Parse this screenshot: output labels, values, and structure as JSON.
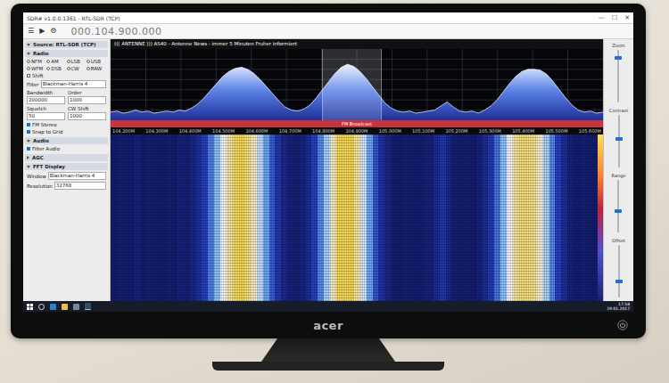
{
  "window": {
    "title": "SDR# v1.0.0.1361 - RTL-SDR (TCP)",
    "controls": [
      "—",
      "☐",
      "✕"
    ]
  },
  "toolbar": {
    "icons": [
      "☰",
      "▶",
      "⚙"
    ],
    "frequency": "000.104.900.000"
  },
  "left_panel": {
    "sections": [
      {
        "title": "Source: RTL-SDR (TCP)",
        "expanded": true,
        "rows": []
      },
      {
        "title": "Radio",
        "expanded": true,
        "rows": [
          {
            "kind": "radios",
            "options": [
              {
                "label": "NFM",
                "selected": false
              },
              {
                "label": "AM",
                "selected": false
              },
              {
                "label": "LSB",
                "selected": false
              },
              {
                "label": "USB",
                "selected": false
              },
              {
                "label": "WFM",
                "selected": true
              },
              {
                "label": "DSB",
                "selected": false
              },
              {
                "label": "CW",
                "selected": false
              },
              {
                "label": "RAW",
                "selected": false
              }
            ]
          },
          {
            "kind": "check",
            "label": "Shift",
            "checked": false
          },
          {
            "kind": "field",
            "label": "Filter",
            "value": "Blackman-Harris 4"
          },
          {
            "kind": "pair",
            "items": [
              {
                "label": "Bandwidth",
                "value": "200000"
              },
              {
                "label": "Order",
                "value": "1000"
              }
            ]
          },
          {
            "kind": "pair",
            "items": [
              {
                "label": "Squelch",
                "value": "50"
              },
              {
                "label": "CW Shift",
                "value": "1000"
              }
            ]
          },
          {
            "kind": "check",
            "label": "FM Stereo",
            "checked": true
          },
          {
            "kind": "check",
            "label": "Snap to Grid",
            "checked": true
          }
        ]
      },
      {
        "title": "Audio",
        "expanded": true,
        "rows": [
          {
            "kind": "check",
            "label": "Filter Audio",
            "checked": true
          }
        ]
      },
      {
        "title": "AGC",
        "expanded": false,
        "rows": []
      },
      {
        "title": "FFT Display",
        "expanded": true,
        "rows": [
          {
            "kind": "field",
            "label": "Window",
            "value": "Blackman-Harris 4"
          },
          {
            "kind": "field",
            "label": "Resolution",
            "value": "32768"
          }
        ]
      }
    ]
  },
  "spectrum": {
    "rds_text": "((( ANTENNE )))  AS40 - Antenne News - immer 5 Minuten Fruher informiert",
    "axis_labels": [
      "104,200M",
      "104,300M",
      "104,400M",
      "104,500M",
      "104,600M",
      "104,700M",
      "104,800M",
      "104,900M",
      "105,000M",
      "105,100M",
      "105,200M",
      "105,300M",
      "105,400M",
      "105,500M",
      "105,600M"
    ],
    "values": [
      -92,
      -91,
      -93,
      -92,
      -90,
      -92,
      -91,
      -93,
      -92,
      -91,
      -92,
      -90,
      -91,
      -88,
      -84,
      -78,
      -71,
      -64,
      -57,
      -52,
      -49,
      -48,
      -50,
      -54,
      -60,
      -67,
      -74,
      -81,
      -87,
      -90,
      -91,
      -89,
      -85,
      -78,
      -70,
      -62,
      -54,
      -48,
      -45,
      -47,
      -52,
      -59,
      -67,
      -75,
      -83,
      -88,
      -91,
      -92,
      -91,
      -93,
      -92,
      -91,
      -90,
      -86,
      -82,
      -87,
      -91,
      -92,
      -91,
      -93,
      -90,
      -86,
      -80,
      -72,
      -64,
      -57,
      -52,
      -50,
      -50,
      -51,
      -55,
      -62,
      -70,
      -78,
      -85,
      -90,
      -92,
      -91,
      -93,
      -92
    ],
    "selection": {
      "start": 0.43,
      "end": 0.55
    },
    "band_plan": {
      "label": "FM Broadcast"
    }
  },
  "side_controls": [
    {
      "label": "Zoom",
      "level": 0.85
    },
    {
      "label": "Contrast",
      "level": 0.55
    },
    {
      "label": "Range",
      "level": 0.4
    },
    {
      "label": "Offset",
      "level": 0.3
    }
  ],
  "taskbar": {
    "time": "17:58",
    "date": "19.01.2017"
  },
  "monitor": {
    "brand": "acer"
  }
}
